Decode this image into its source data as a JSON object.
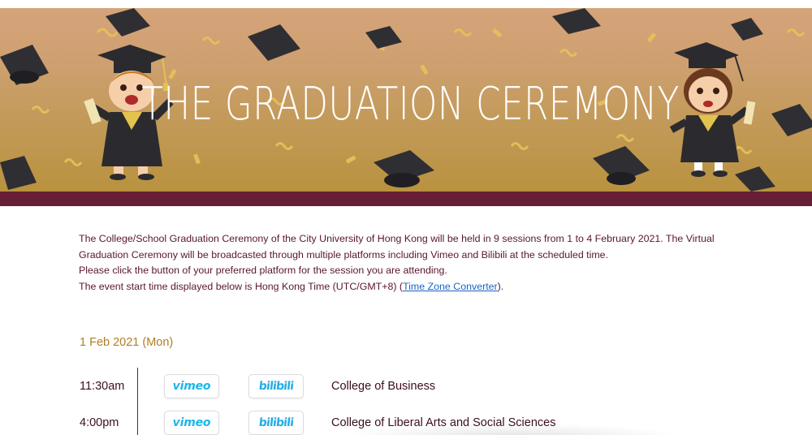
{
  "banner": {
    "title": "THE GRADUATION CEREMONY",
    "colors": {
      "gradient_top": "#d6a37a",
      "gradient_bottom": "#b9923f",
      "stripe": "#661f37"
    },
    "decorations": [
      "graduate-boy-illustration",
      "graduate-girl-illustration",
      "graduation-cap-icon",
      "confetti"
    ]
  },
  "intro": {
    "paragraph1": "The College/School Graduation Ceremony of the City University of Hong Kong will be held in 9 sessions from 1 to 4 February 2021. The Virtual Graduation Ceremony will be broadcasted through multiple platforms including Vimeo and Bilibili at the scheduled time.",
    "paragraph2": "Please click the button of your preferred platform for the session you are attending.",
    "paragraph3_prefix": "The event start time displayed below is Hong Kong Time (UTC/GMT+8) (",
    "converter_link": "Time Zone Converter",
    "paragraph3_suffix": ")."
  },
  "schedule": {
    "date": "1 Feb 2021 (Mon)",
    "sessions": [
      {
        "time": "11:30am",
        "vimeo_label": "vimeo",
        "bilibili_label": "bilibili",
        "name": "College of Business"
      },
      {
        "time": "4:00pm",
        "vimeo_label": "vimeo",
        "bilibili_label": "bilibili",
        "name": "College of Liberal Arts and Social Sciences"
      }
    ]
  },
  "colors": {
    "date_heading": "#b07f25",
    "body_text": "#5a1530",
    "link": "#1a63c8",
    "vimeo_blue": "#1ab7ea",
    "bilibili_blue": "#23ade5"
  }
}
